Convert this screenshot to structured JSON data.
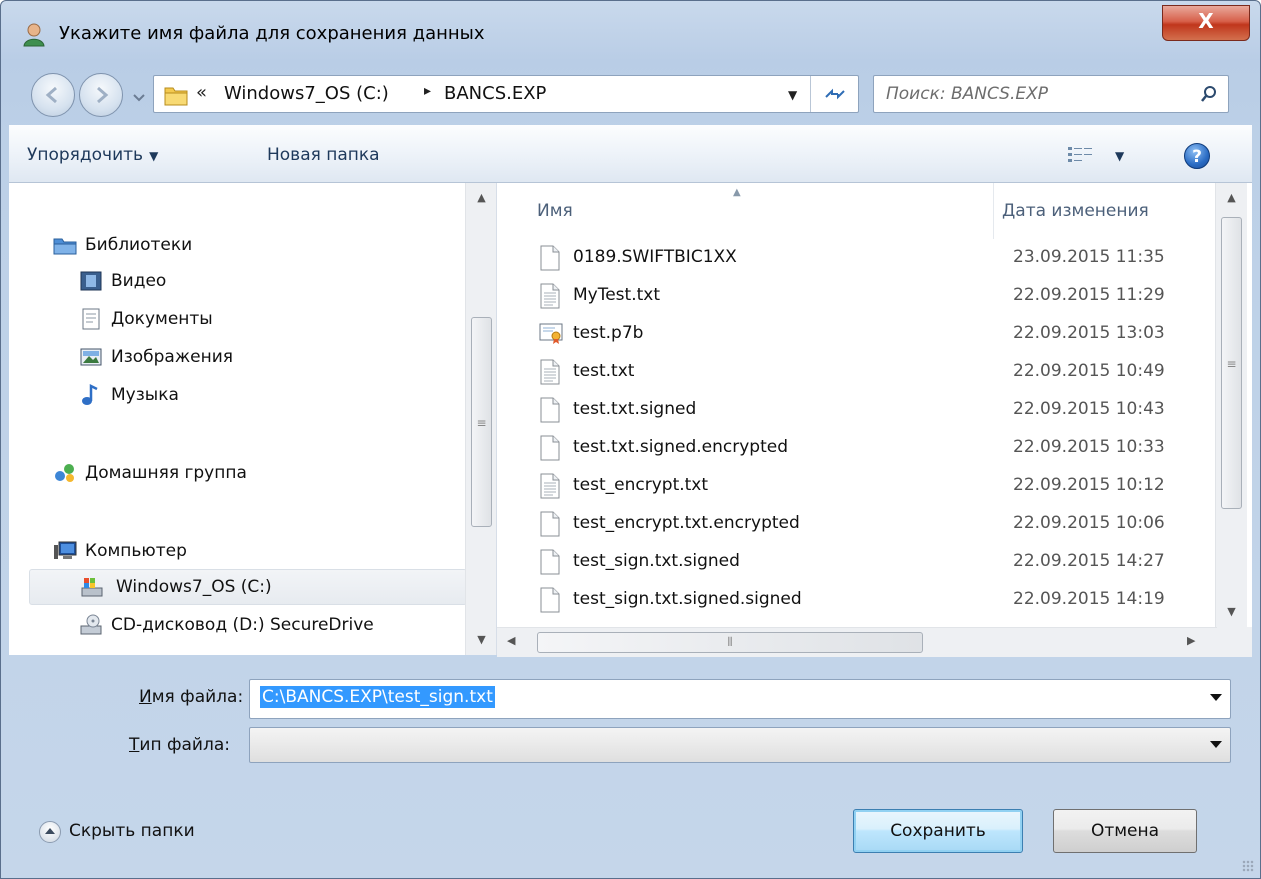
{
  "window": {
    "title": "Укажите имя файла для сохранения данных",
    "close_glyph": "X"
  },
  "address": {
    "chevron": "«",
    "segment1": "Windows7_OS (C:)",
    "separator": "▸",
    "segment2": "BANCS.EXP"
  },
  "search": {
    "placeholder": "Поиск: BANCS.EXP"
  },
  "toolbar": {
    "organize_label": "Упорядочить",
    "new_folder_label": "Новая папка",
    "help_glyph": "?"
  },
  "nav": {
    "libraries": "Библиотеки",
    "video": "Видео",
    "documents": "Документы",
    "pictures": "Изображения",
    "music": "Музыка",
    "homegroup": "Домашняя группа",
    "computer": "Компьютер",
    "drive_c": "Windows7_OS (C:)",
    "drive_d": "CD-дисковод (D:) SecureDrive"
  },
  "columns": {
    "name": "Имя",
    "date": "Дата изменения"
  },
  "files": [
    {
      "name": "0189.SWIFTBIC1XX",
      "date": "23.09.2015 11:35",
      "icon": "blank-file-icon"
    },
    {
      "name": "MyTest.txt",
      "date": "22.09.2015 11:29",
      "icon": "text-file-icon"
    },
    {
      "name": "test.p7b",
      "date": "22.09.2015 13:03",
      "icon": "certificate-file-icon"
    },
    {
      "name": "test.txt",
      "date": "22.09.2015 10:49",
      "icon": "text-file-icon"
    },
    {
      "name": "test.txt.signed",
      "date": "22.09.2015 10:43",
      "icon": "blank-file-icon"
    },
    {
      "name": "test.txt.signed.encrypted",
      "date": "22.09.2015 10:33",
      "icon": "blank-file-icon"
    },
    {
      "name": "test_encrypt.txt",
      "date": "22.09.2015 10:12",
      "icon": "text-file-icon"
    },
    {
      "name": "test_encrypt.txt.encrypted",
      "date": "22.09.2015 10:06",
      "icon": "blank-file-icon"
    },
    {
      "name": "test_sign.txt.signed",
      "date": "22.09.2015 14:27",
      "icon": "blank-file-icon"
    },
    {
      "name": "test_sign.txt.signed.signed",
      "date": "22.09.2015 14:19",
      "icon": "blank-file-icon"
    }
  ],
  "form": {
    "filename_label_mnemonic": "И",
    "filename_label_rest": "мя файла:",
    "filename_value": "C:\\BANCS.EXP\\test_sign.txt",
    "filetype_label_mnemonic": "Т",
    "filetype_label_rest": "ип файла:",
    "filetype_value": ""
  },
  "footer": {
    "hide_folders_label": "Скрыть папки",
    "save_label": "Сохранить",
    "cancel_label": "Отмена"
  }
}
